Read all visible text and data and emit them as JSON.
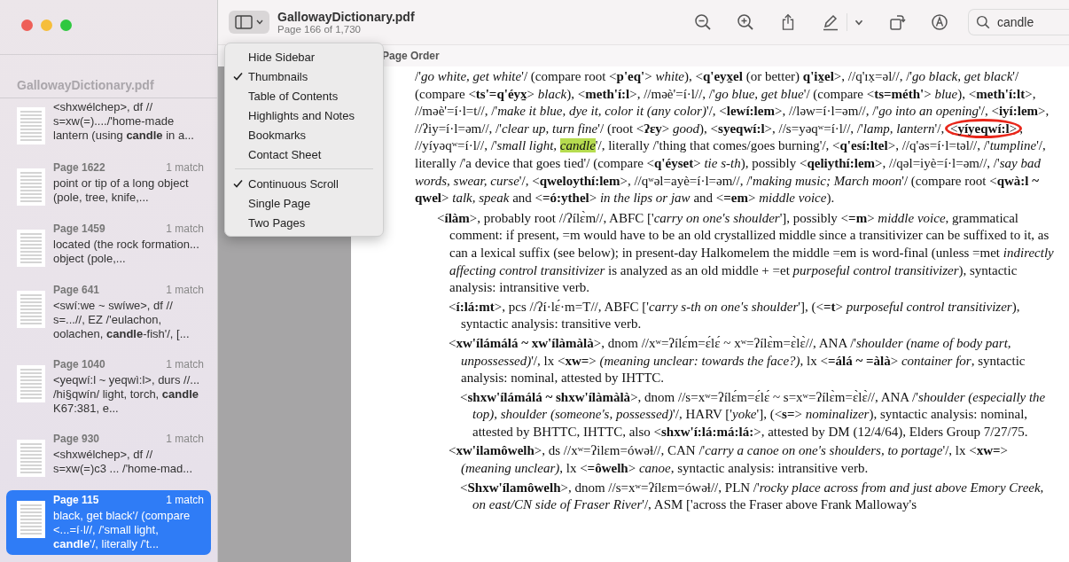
{
  "window": {
    "title": "GallowayDictionary.pdf",
    "subtitle": "Page 166 of 1,730"
  },
  "search": {
    "value": "candle"
  },
  "sidebar": {
    "title": "GallowayDictionary.pdf",
    "results": [
      {
        "snippet": "<shxwélchep>, df // s=xw(=)..../'home-made lantern (using **candle** in a...",
        "selected": false
      },
      {
        "page": "Page 1622",
        "matches": "1 match",
        "snippet": "point or tip of a long object (pole, tree, knife,...",
        "selected": false
      },
      {
        "page": "Page 1459",
        "matches": "1 match",
        "snippet": "located (the rock formation... object (pole,...",
        "selected": false
      },
      {
        "page": "Page 641",
        "matches": "1 match",
        "snippet": "<swí:we ~ swíwe>, df // s=...//, EZ /'eulachon, oolachen, **candle**-fish'/, [...",
        "selected": false
      },
      {
        "page": "Page 1040",
        "matches": "1 match",
        "snippet": "<yeqwí:l ~ yeqwì:l>, durs //... /hi§qwín/ light, torch, **candle** K67:381, e...",
        "selected": false
      },
      {
        "page": "Page 930",
        "matches": "1 match",
        "snippet": "<shxwélchep>, df // s=xw(=)c3 ... /'home-mad...",
        "selected": false
      },
      {
        "page": "Page 115",
        "matches": "1 match",
        "snippet": "black, get black'/ (compare <...=í·l//, /'small light, **candle**'/, literally /'t...",
        "selected": true
      }
    ]
  },
  "view_menu": {
    "items": [
      {
        "label": "Hide Sidebar",
        "checked": false,
        "divider_before": false
      },
      {
        "label": "Thumbnails",
        "checked": true,
        "divider_before": false
      },
      {
        "label": "Table of Contents",
        "checked": false,
        "divider_before": false
      },
      {
        "label": "Highlights and Notes",
        "checked": false,
        "divider_before": false
      },
      {
        "label": "Bookmarks",
        "checked": false,
        "divider_before": false
      },
      {
        "label": "Contact Sheet",
        "checked": false,
        "divider_before": false
      },
      {
        "label": "Continuous Scroll",
        "checked": true,
        "divider_before": true
      },
      {
        "label": "Single Page",
        "checked": false,
        "divider_before": false
      },
      {
        "label": "Two Pages",
        "checked": false,
        "divider_before": false
      }
    ]
  },
  "header_label": "Page Order",
  "document": {
    "lead": [
      {
        "text": "/'*go white, get white*'/ (compare root <**p'eq'**> *white*), <**q'eyx̱el** (or better) **q'ix̱el**>, //q'ɪx̣=əl//, /'*go black, get black*'/ (compare <**ts'=q'éyx̱**> *black*), <**meth'í:l**>, //məè'=í·l//, /'*go blue, get blue*'/ (compare <**ts=méth'**> *blue*), <**meth'í:lt**>, //məè'=í·l=t//, /'*make it blue, dye it, color it (any color)*'/, <**lewí:lem**>, //ləw=í·l=əm//, /'*go into an opening*'/, <**iyí:lem**>, //ʔiy=í·l=əm//, /'*clear up, turn fine*'/ (root <**ʔɛy**> *good*), <**syeqwí:l**>, //s=yəqʷ=í·l//, /'*lamp, lantern*'/, ",
        "circled": false,
        "highlighted": false
      },
      {
        "text": "<**yíyeqwí:l**>",
        "circled": true,
        "highlighted": false
      },
      {
        "text": ", //yíyəqʷ=í·l//, /'*small light,* ",
        "circled": false,
        "highlighted": false
      },
      {
        "text": "*candle*",
        "circled": false,
        "highlighted": true
      },
      {
        "text": "'/, literally /'thing that comes/goes burning'/, <**q'esí:ltel**>, //q'əs=í·l=təl//, /'*tumpline*'/, literally /'a device that goes tied'/ (compare <**q'éyset**> *tie s-th*), possibly <**qeliythí:lem**>, //qəl=iyè=í·l=əm//, /'*say bad words, swear, curse*'/, <**qweloythí:lem**>, //qʷəl=ayè=í·l=əm//, /'*making music; March moon*'/ (compare root <**qwà:l ~ qwel**> *talk, speak* and <**=ó:ythel**> *in the lips or jaw* and <**=em**> *middle voice*).",
        "circled": false,
        "highlighted": false
      }
    ],
    "entries": [
      {
        "text": "<**ílàm**>, probably root //ʔílɛ̀m//, ABFC ['*carry on one's shoulder*'], possibly <**=m**> *middle voice*, grammatical comment: if present, =m would have to be an old crystallized middle since a transitivizer can be suffixed to it, as can a lexical suffix (see below); in present-day Halkomelem the middle =em is word-final (unless =met *indirectly affecting control transitivizer* is analyzed as an old middle + =et *purposeful control transitivizer*), syntactic analysis: intransitive verb.",
        "children": [
          {
            "text": "<**í:lá:mt**>, pcs //ʔí·lɛ́·m=T//, ABFC ['*carry s-th on one's shoulder*'], (<**=t**> *purposeful control transitivizer*), syntactic analysis: transitive verb."
          },
          {
            "text": "<**xw'ílámálá ~ xw'ílàmàlà**>, dnom //xʷ=ʔílɛ́m=ɛ́lɛ́ ~ xʷ=ʔílɛ̀m=ɛ̀lɛ̀//, ANA /'*shoulder (name of body part, unpossessed)*'/, lx <**xw=**> *(meaning unclear: towards the face?)*, lx <**=álá ~ =àlà**> *container for*, syntactic analysis: nominal, attested by IHTTC.",
            "children": [
              {
                "text": "<**shxw'ílámálá ~ shxw'ílàmàlà**>, dnom //s=xʷ=ʔílɛ́m=ɛ́lɛ́ ~ s=xʷ=ʔílɛ̀m=ɛ̀lɛ̀//, ANA /'*shoulder (especially the top), shoulder (someone's, possessed)*'/, HARV ['*yoke*'], (<**s=**> *nominalizer*), syntactic analysis: nominal, attested by BHTTC, IHTTC, also <**shxw'í:lá:má:lá:**>, attested by DM (12/4/64), Elders Group 7/27/75."
              }
            ]
          },
          {
            "text": "<**xw'ilamôwelh**>, ds //xʷ=ʔilɛm=ówəɬ//, CAN /'*carry a canoe on one's shoulders, to portage*'/, lx <**xw=**> *(meaning unclear)*, lx <**=ôwelh**> *canoe*, syntactic analysis: intransitive verb.",
            "children": [
              {
                "text": "<**Shxw'ílamôwelh**>, dnom //s=xʷ=ʔílɛm=ówəɬ//, PLN /'*rocky place across from and just above Emory Creek, on east/CN side of Fraser River*'/, ASM ['across the Fraser above Frank Malloway's"
              }
            ]
          }
        ]
      }
    ]
  }
}
